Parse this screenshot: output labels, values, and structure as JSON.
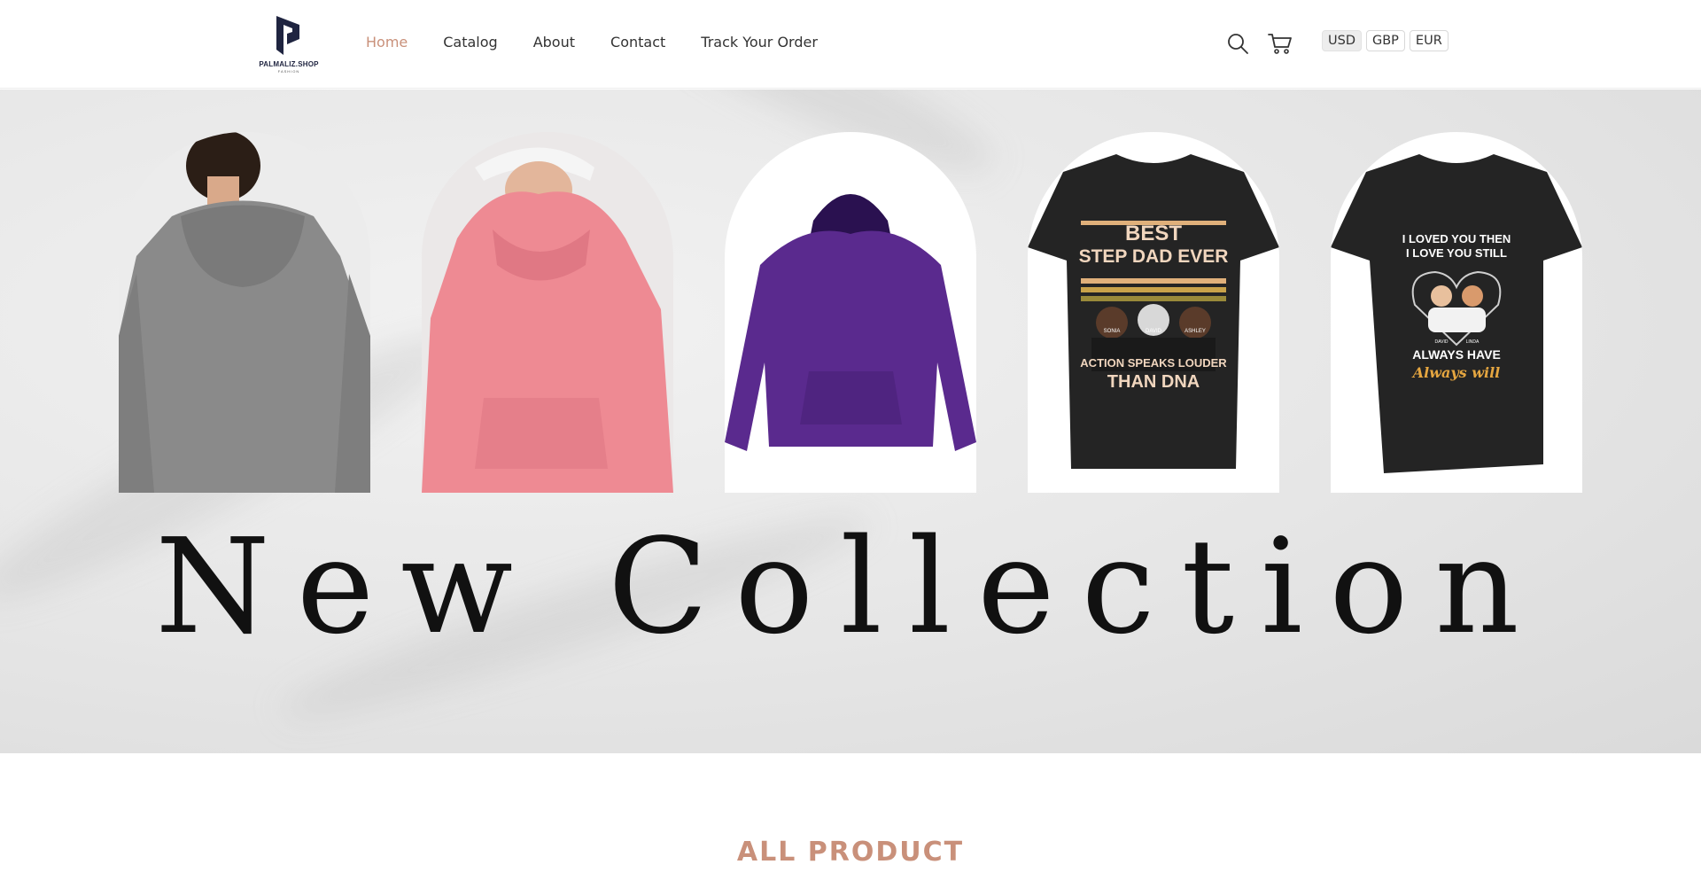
{
  "brand": {
    "name": "PALMALIZ.SHOP",
    "tagline": "FASHION"
  },
  "nav": {
    "items": [
      {
        "label": "Home",
        "active": true
      },
      {
        "label": "Catalog",
        "active": false
      },
      {
        "label": "About",
        "active": false
      },
      {
        "label": "Contact",
        "active": false
      },
      {
        "label": "Track Your Order",
        "active": false
      }
    ]
  },
  "header_icons": [
    "search-icon",
    "cart-icon"
  ],
  "currency": {
    "options": [
      "USD",
      "GBP",
      "EUR"
    ],
    "selected": "USD"
  },
  "hero": {
    "title": "New Collection",
    "products": [
      {
        "name": "gray-hoodie-back",
        "color": "#8a8a8a"
      },
      {
        "name": "pink-hoodie",
        "color": "#ee8a93"
      },
      {
        "name": "purple-hoodie",
        "color": "#5a2a8e"
      },
      {
        "name": "step-dad-tshirt",
        "color": "#242424",
        "print": [
          "BEST",
          "STEP DAD EVER",
          "SONIA",
          "DAVID",
          "ASHLEY",
          "ACTION SPEAKS LOUDER",
          "THAN DNA"
        ]
      },
      {
        "name": "love-tshirt",
        "color": "#242424",
        "print": [
          "I LOVED YOU THEN",
          "I LOVE YOU STILL",
          "DAVID",
          "LINDA",
          "ALWAYS HAVE",
          "Always will"
        ]
      }
    ]
  },
  "section": {
    "title": "ALL PRODUCT"
  },
  "colors": {
    "accent": "#c9907a",
    "text": "#333333",
    "brand": "#1f2440"
  }
}
